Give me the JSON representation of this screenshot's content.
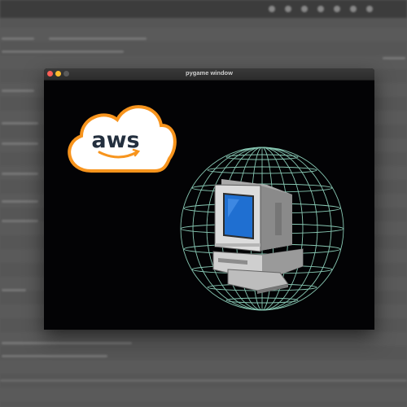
{
  "window": {
    "title": "pygame window"
  },
  "logo": {
    "text": "aws",
    "brand_colors": {
      "outline": "#f7941d",
      "text": "#232f3e",
      "smile": "#f7941d",
      "fill": "#ffffff"
    }
  },
  "scene": {
    "globe_color": "#9de8d0",
    "computer_colors": {
      "body": "#d9d9d9",
      "screen": "#1f6fd1",
      "shadow": "#6e6e6e"
    }
  },
  "icons": [
    "close-icon",
    "minimize-icon",
    "maximize-icon",
    "cloud-icon",
    "globe-icon",
    "computer-icon"
  ]
}
